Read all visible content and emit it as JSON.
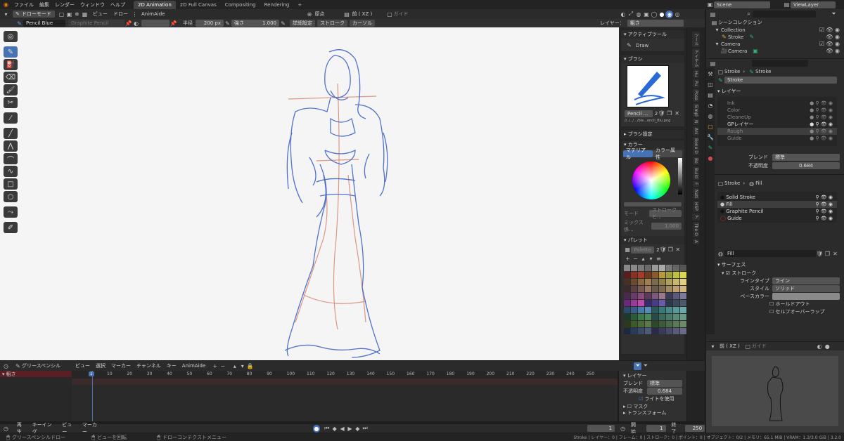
{
  "menubar": {
    "items": [
      "ファイル",
      "編集",
      "レンダー",
      "ウィンドウ",
      "ヘルプ"
    ],
    "workspaces": [
      "2D Animation",
      "2D Full Canvas",
      "Compositing",
      "Rendering"
    ],
    "add": "+",
    "scene": "Scene",
    "view_layer": "ViewLayer"
  },
  "header": {
    "mode": "ドローモード",
    "view": "ビュー",
    "draw": "ドロー",
    "anim": "AnimAide",
    "orientation": "原点",
    "view_axis": "前 ( XZ )",
    "guide": "ガイド"
  },
  "toolbar": {
    "material": "Pencil Blue",
    "brush": "Graphite Pencil",
    "radius_label": "半径",
    "radius_value": "200 px",
    "strength_label": "強さ",
    "strength_value": "1.000",
    "advanced": "詳細設定",
    "stroke": "ストローク",
    "cursor": "カーソル",
    "layer_label": "レイヤー：",
    "layer_value": "粗さ"
  },
  "n_panel": {
    "active_tool": "アクティブツール",
    "tool_name": "Draw",
    "brush_title": "ブラシ",
    "brush_name": "Pencil ...",
    "brush_users": "2",
    "brush_path": "//../../.../ble...encil_Blu.png",
    "brush_settings": "ブラシ設定",
    "color_title": "カラー",
    "tab_material": "マテリアル",
    "tab_color_attr": "カラー属性",
    "mode_label": "モード",
    "mode_value": "ストロークと...",
    "mix_label": "ミックス係...",
    "mix_value": "1.000",
    "palette_title": "パレット",
    "palette_name": "Palette",
    "palette_users": "2"
  },
  "outliner": {
    "title": "シーンコレクション",
    "items": [
      "Collection",
      "Stroke",
      "Camera",
      "Camera"
    ]
  },
  "props": {
    "obj_name": "Stroke",
    "data_name": "Stroke",
    "data_field": "Stroke",
    "layer_title": "レイヤー",
    "layers": [
      "Ink",
      "Color",
      "CleaneUp",
      "GPレイヤー",
      "Rough",
      "Guide"
    ],
    "blend_label": "ブレンド",
    "blend_value": "標準",
    "opacity_label": "不透明度",
    "opacity_value": "0.684",
    "mat_obj": "Stroke",
    "mat_name": "Fill",
    "materials": [
      "Solid Stroke",
      "Fill",
      "Graphite Pencil",
      "Guide"
    ],
    "mat_field": "Fill",
    "surface": "サーフェス",
    "stroke_section": "ストローク",
    "line_type_label": "ラインタイプ",
    "line_type_value": "ライン",
    "style_label": "スタイル",
    "style_value": "ソリッド",
    "base_color_label": "ベースカラー",
    "holdout": "ホールドアウト",
    "self_overlap": "セルフオーバーラップ",
    "mini_view": "前 ( XZ )",
    "mini_guide": "ガイド"
  },
  "side_tabs": [
    "ツール",
    "アイテム",
    "Hu",
    "Pu",
    "Pose",
    "Simpl",
    "N",
    "Ani",
    "Bone D",
    "Be",
    "Build",
    "F",
    "Nati",
    "HSP",
    "ア",
    "The O",
    "A"
  ],
  "timeline": {
    "editor": "グリースペンシル",
    "menus": [
      "ビュー",
      "選択",
      "マーカー",
      "チャンネル",
      "キー",
      "AnimAide"
    ],
    "channel": "粗さ",
    "frames": [
      "1",
      "10",
      "20",
      "30",
      "40",
      "50",
      "60",
      "70",
      "80",
      "90",
      "100",
      "110",
      "120",
      "130",
      "140",
      "150",
      "160",
      "170",
      "180",
      "190",
      "200",
      "210",
      "220",
      "230",
      "240",
      "250"
    ],
    "layer_title": "レイヤー",
    "blend_label": "ブレンド",
    "blend_value": "標準",
    "opacity_label": "不透明度",
    "opacity_value": "0.684",
    "use_lights": "ライトを使用",
    "mask": "マスク",
    "transform": "トランスフォーム"
  },
  "playback": {
    "play": "再生",
    "keying": "キーイング",
    "view": "ビュー",
    "marker": "マーカー",
    "current": "1",
    "start_label": "開始",
    "start": "1",
    "end_label": "終了",
    "end": "250"
  },
  "statusbar": {
    "left": "グリースペンシルドロー",
    "mid1": "ビューを回転",
    "mid2": "ドローコンテクストメニュー",
    "right": "Stroke | レイヤー：0 | フレーム：0 | ストローク：0 | ポイント：0 | オブジェクト：0/2 | メモリ：65.1 MiB | VRAM：1.3/3.0 GiB | 3.2.0"
  },
  "colors": {
    "accent": "#4772b3",
    "sketch_blue": "#3f63c8",
    "sketch_red": "#d88670"
  }
}
